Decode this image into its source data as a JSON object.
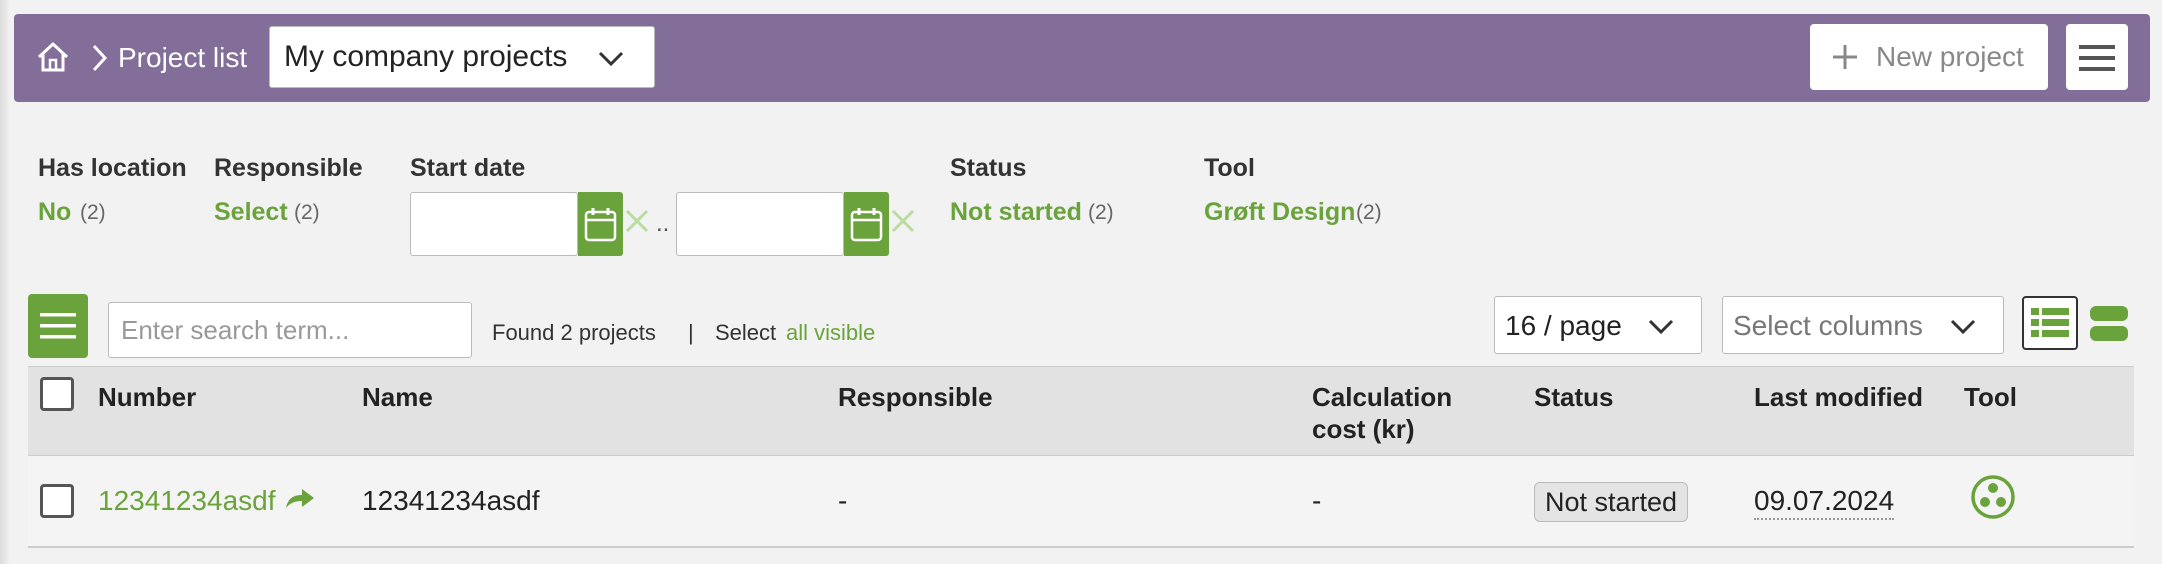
{
  "header": {
    "breadcrumb_label": "Project list",
    "project_selector_value": "My company projects",
    "new_project_label": "New project"
  },
  "filters": {
    "has_location": {
      "label": "Has location",
      "value": "No",
      "count": "(2)"
    },
    "responsible": {
      "label": "Responsible",
      "value": "Select",
      "count": "(2)"
    },
    "start_date": {
      "label": "Start date",
      "range_separator": ".."
    },
    "status": {
      "label": "Status",
      "value": "Not started",
      "count": "(2)"
    },
    "tool": {
      "label": "Tool",
      "value": "Grøft Design",
      "count": "(2)"
    }
  },
  "toolbar": {
    "search_placeholder": "Enter search term...",
    "found_text": "Found 2 projects",
    "separator": "|",
    "select_label": "Select",
    "select_all_visible": "all visible",
    "page_size": "16 / page",
    "columns_placeholder": "Select columns"
  },
  "table": {
    "columns": [
      "Number",
      "Name",
      "Responsible",
      "Calculation cost (kr)",
      "Status",
      "Last modified",
      "Tool"
    ],
    "column_calc_line1": "Calculation",
    "column_calc_line2": "cost (kr)",
    "rows": [
      {
        "number": "12341234asdf",
        "name": "12341234asdf",
        "responsible": "-",
        "calculation_cost": "-",
        "status": "Not started",
        "last_modified": "09.07.2024",
        "tool_icon": "groft-design-tool-icon"
      }
    ]
  },
  "colors": {
    "header_bg": "#836e9a",
    "accent_green": "#6aa33b",
    "page_bg": "#f2f2f2",
    "table_head_bg": "#e2e2e2"
  },
  "icons": {
    "home": "home-icon",
    "breadcrumb_separator": "chevron-right-icon",
    "dropdown": "chevron-down-icon",
    "add": "plus-icon",
    "menu": "hamburger-icon",
    "calendar": "calendar-icon",
    "clear": "close-icon",
    "share": "share-arrow-icon",
    "list_view": "list-view-icon",
    "compact_view": "compact-rows-icon"
  }
}
